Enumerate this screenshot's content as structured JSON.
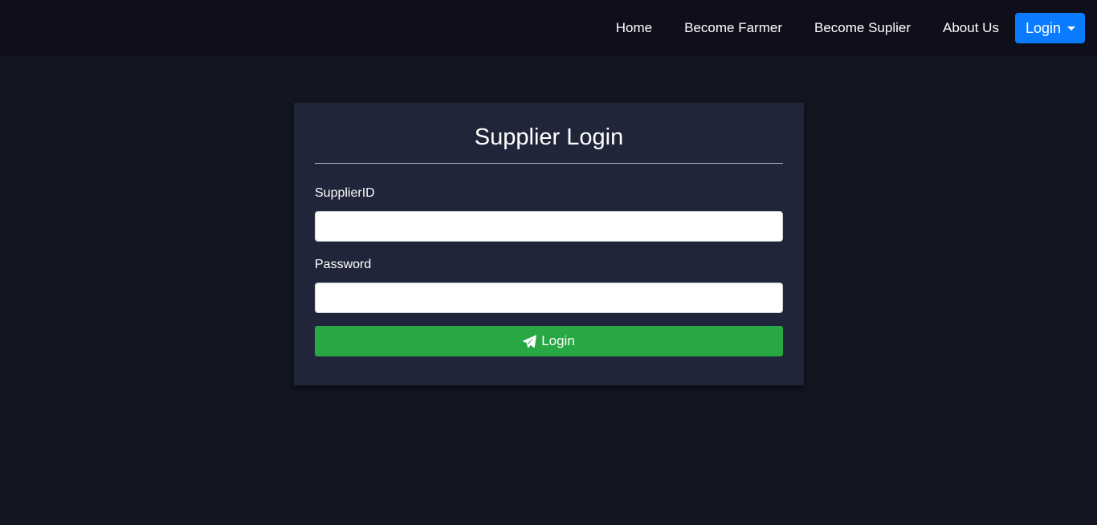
{
  "navbar": {
    "links": [
      {
        "label": "Home"
      },
      {
        "label": "Become Farmer"
      },
      {
        "label": "Become Suplier"
      },
      {
        "label": "About Us"
      }
    ],
    "login_dropdown_label": "Login",
    "login_dropdown_color": "#0a7bff"
  },
  "login_card": {
    "title": "Supplier Login",
    "supplier_id_label": "SupplierID",
    "supplier_id_value": "",
    "password_label": "Password",
    "password_value": "",
    "submit_label": "Login",
    "submit_icon": "paper-plane-icon",
    "submit_color": "#28a745"
  }
}
